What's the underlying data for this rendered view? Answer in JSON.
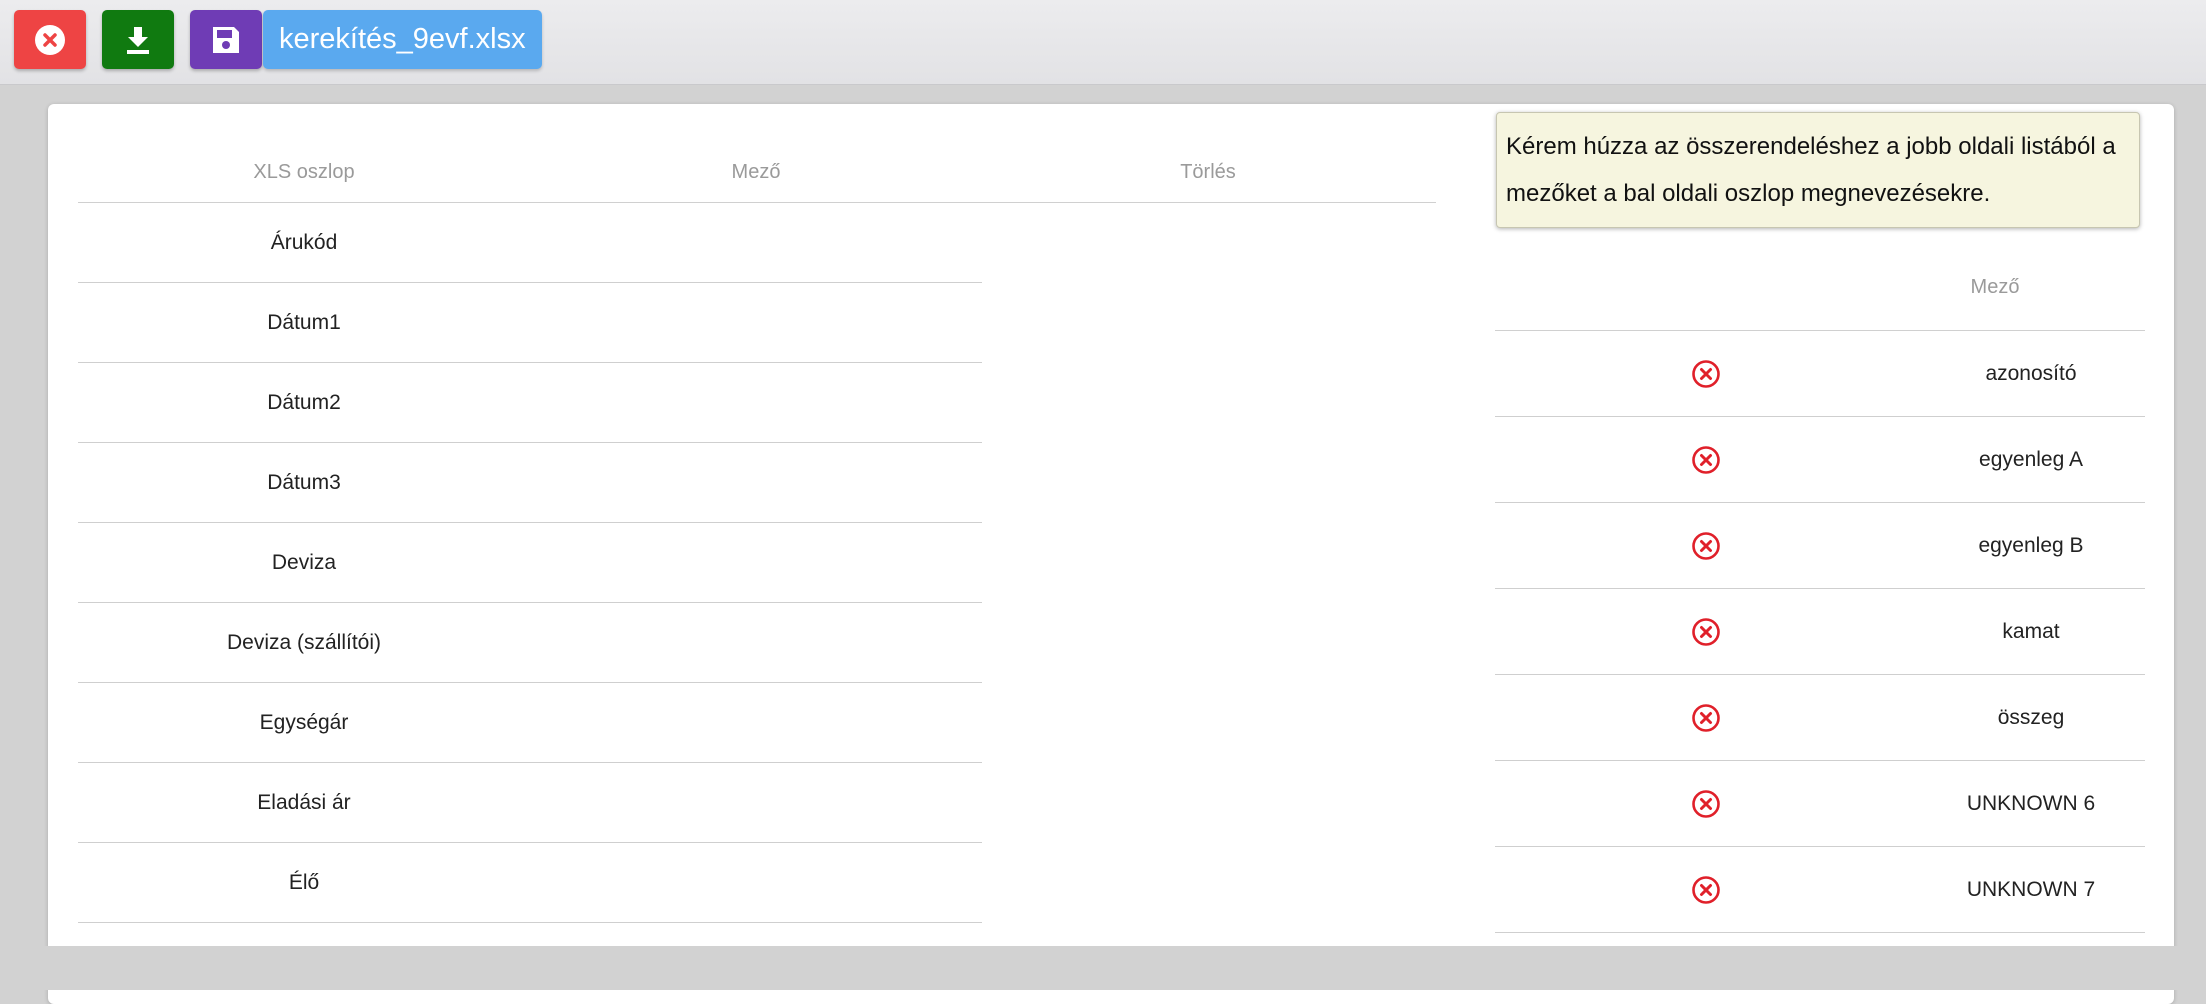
{
  "toolbar": {
    "filename": "kerekítés_9evf.xlsx"
  },
  "left_table": {
    "headers": [
      "XLS oszlop",
      "Mező",
      "Törlés"
    ],
    "rows": [
      "Árukód",
      "Dátum1",
      "Dátum2",
      "Dátum3",
      "Deviza",
      "Deviza (szállítói)",
      "Egységár",
      "Eladási ár",
      "Élő"
    ]
  },
  "hint": {
    "text": "Kérem húzza az összerendeléshez a jobb oldali listából a mezőket a bal oldali oszlop megnevezésekre."
  },
  "right_table": {
    "header": "Mező",
    "rows": [
      "azonosító",
      "egyenleg A",
      "egyenleg B",
      "kamat",
      "összeg",
      "UNKNOWN 6",
      "UNKNOWN 7"
    ]
  },
  "colors": {
    "close": "#ee4444",
    "download": "#107a10",
    "save": "#6f3cb5",
    "file": "#5aa9ef",
    "remove_icon": "#e0202a"
  }
}
